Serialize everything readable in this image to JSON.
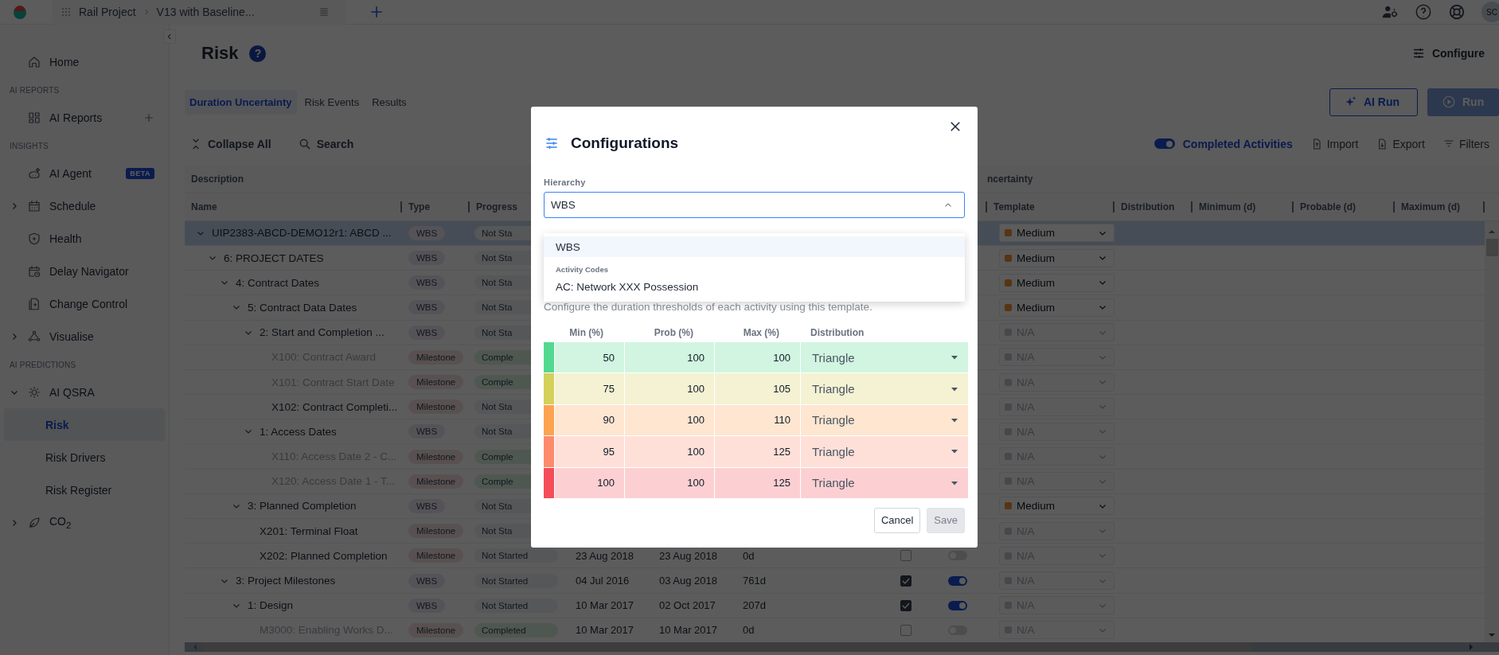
{
  "topbar": {
    "breadcrumb": [
      "Rail Project",
      "V13 with Baseline..."
    ],
    "avatar": "SC"
  },
  "sidebar": {
    "items": [
      {
        "kind": "item",
        "label": "Home",
        "selected": false
      },
      {
        "kind": "section",
        "label": "AI REPORTS"
      },
      {
        "kind": "item",
        "label": "AI Reports",
        "selected": false,
        "add": true
      },
      {
        "kind": "section",
        "label": "INSIGHTS"
      },
      {
        "kind": "item",
        "label": "AI Agent",
        "selected": false,
        "badge": "BETA"
      },
      {
        "kind": "item",
        "label": "Schedule",
        "selected": false,
        "expanded": false
      },
      {
        "kind": "item",
        "label": "Health",
        "selected": false
      },
      {
        "kind": "item",
        "label": "Delay Navigator",
        "selected": false
      },
      {
        "kind": "item",
        "label": "Change Control",
        "selected": false
      },
      {
        "kind": "item",
        "label": "Visualise",
        "selected": false,
        "expanded": false
      },
      {
        "kind": "section",
        "label": "AI PREDICTIONS"
      },
      {
        "kind": "item",
        "label": "AI QSRA",
        "selected": false,
        "expanded": true,
        "children": [
          {
            "label": "Risk",
            "selected": true
          },
          {
            "label": "Risk Drivers",
            "selected": false
          },
          {
            "label": "Risk Register",
            "selected": false
          }
        ]
      },
      {
        "kind": "item",
        "label": "CO$_{2}$",
        "selected": false,
        "expanded": false
      }
    ]
  },
  "page": {
    "title": "Risk",
    "help_glyph": "?",
    "configure": "Configure",
    "tabs": [
      {
        "label": "Duration Uncertainty",
        "selected": true
      },
      {
        "label": "Risk Events",
        "selected": false
      },
      {
        "label": "Results",
        "selected": false
      }
    ],
    "run_buttons": [
      {
        "label": "AI Run",
        "kind": "outline",
        "disabled": false
      },
      {
        "label": "Run",
        "kind": "filled",
        "disabled": true
      }
    ],
    "toolbar": {
      "collapse": "Collapse All",
      "search": "Search",
      "completed": {
        "label": "Completed Activities",
        "on": true
      },
      "actions": [
        "Import",
        "Export",
        "Filters"
      ]
    }
  },
  "table": {
    "group_headers": [
      "Description",
      "ncertainty"
    ],
    "columns": [
      "Name",
      "Type",
      "Progress",
      "Template",
      "Distribution",
      "Minimum (d)",
      "Probable (d)",
      "Maximum (d)"
    ],
    "rows": [
      {
        "name": "UIP2383-ABCD-DEMO12r1: ABCD ...",
        "kind": "wbs",
        "type": "WBS",
        "progress": "Not Sta",
        "completed": false,
        "selected": true,
        "expanded": true,
        "template": {
          "label": "Medium",
          "disabled": false
        },
        "children": [
          {
            "name": "6: PROJECT DATES",
            "kind": "wbs",
            "type": "WBS",
            "progress": "Not Sta",
            "completed": false,
            "selected": false,
            "expanded": true,
            "template": {
              "label": "Medium",
              "disabled": false
            },
            "children": [
              {
                "name": "4: Contract Dates",
                "kind": "wbs",
                "type": "WBS",
                "progress": "Not Sta",
                "completed": false,
                "selected": false,
                "expanded": true,
                "template": {
                  "label": "Medium",
                  "disabled": false
                },
                "children": [
                  {
                    "name": "5: Contract Data Dates",
                    "kind": "wbs",
                    "type": "WBS",
                    "progress": "Not Sta",
                    "completed": false,
                    "selected": false,
                    "expanded": true,
                    "template": {
                      "label": "Medium",
                      "disabled": false
                    },
                    "children": [
                      {
                        "name": "2: Start and Completion ...",
                        "kind": "wbs",
                        "type": "WBS",
                        "progress": "Not Sta",
                        "completed": false,
                        "selected": false,
                        "expanded": true,
                        "template": {
                          "label": "N/A",
                          "disabled": true
                        },
                        "children": [
                          {
                            "name": "X100: Contract Award",
                            "kind": "milestone",
                            "type": "Milestone",
                            "progress": "Comple",
                            "completed": true,
                            "selected": false,
                            "template": {
                              "label": "N/A",
                              "disabled": true
                            }
                          },
                          {
                            "name": "X101: Contract Start Date",
                            "kind": "milestone",
                            "type": "Milestone",
                            "progress": "Comple",
                            "completed": true,
                            "selected": false,
                            "template": {
                              "label": "N/A",
                              "disabled": true
                            }
                          },
                          {
                            "name": "X102: Contract Completi...",
                            "kind": "milestone",
                            "type": "Milestone",
                            "progress": "Not Sta",
                            "completed": false,
                            "selected": false,
                            "template": {
                              "label": "N/A",
                              "disabled": true
                            }
                          }
                        ]
                      },
                      {
                        "name": "1: Access Dates",
                        "kind": "wbs",
                        "type": "WBS",
                        "progress": "Not Sta",
                        "completed": false,
                        "selected": false,
                        "expanded": true,
                        "template": {
                          "label": "N/A",
                          "disabled": true
                        },
                        "children": [
                          {
                            "name": "X110: Access Date 2 - C...",
                            "kind": "milestone",
                            "type": "Milestone",
                            "progress": "Comple",
                            "completed": true,
                            "selected": false,
                            "template": {
                              "label": "N/A",
                              "disabled": true
                            }
                          },
                          {
                            "name": "X120: Access Date 1 - T...",
                            "kind": "milestone",
                            "type": "Milestone",
                            "progress": "Comple",
                            "completed": true,
                            "selected": false,
                            "template": {
                              "label": "N/A",
                              "disabled": true
                            }
                          }
                        ]
                      }
                    ]
                  },
                  {
                    "name": "3: Planned Completion",
                    "kind": "wbs",
                    "type": "WBS",
                    "progress": "Not Sta",
                    "completed": false,
                    "selected": false,
                    "expanded": true,
                    "template": {
                      "label": "Medium",
                      "disabled": false
                    },
                    "children": [
                      {
                        "name": "X201: Terminal Float",
                        "kind": "milestone",
                        "type": "Milestone",
                        "progress": "Not Sta",
                        "completed": false,
                        "selected": false,
                        "template": {
                          "label": "N/A",
                          "disabled": true
                        }
                      },
                      {
                        "name": "X202: Planned Completion",
                        "kind": "milestone",
                        "type": "Milestone",
                        "progress": "Not Started",
                        "completed": false,
                        "selected": false,
                        "start": "23 Aug 2018",
                        "finish": "23 Aug 2018",
                        "duration": "0d",
                        "checked": false,
                        "toggle_on": false,
                        "template": {
                          "label": "N/A",
                          "disabled": true
                        }
                      }
                    ]
                  }
                ]
              },
              {
                "name": "3: Project Milestones",
                "kind": "wbs",
                "type": "WBS",
                "progress": "Not Started",
                "completed": false,
                "selected": false,
                "expanded": true,
                "start": "04 Jul 2016",
                "finish": "03 Aug 2018",
                "duration": "761d",
                "checked": true,
                "toggle_on": true,
                "template": {
                  "label": "N/A",
                  "disabled": true
                },
                "children": [
                  {
                    "name": "1: Design",
                    "kind": "wbs",
                    "type": "WBS",
                    "progress": "Not Started",
                    "completed": false,
                    "selected": false,
                    "expanded": true,
                    "start": "10 Mar 2017",
                    "finish": "02 Oct 2017",
                    "duration": "207d",
                    "checked": true,
                    "toggle_on": true,
                    "template": {
                      "label": "N/A",
                      "disabled": true
                    },
                    "children": [
                      {
                        "name": "M3000: Enabling Works D...",
                        "kind": "milestone",
                        "type": "Milestone",
                        "progress": "Completed",
                        "completed": true,
                        "selected": false,
                        "start": "10 Mar 2017",
                        "finish": "10 Mar 2017",
                        "duration": "0d",
                        "checked": false,
                        "toggle_on": false,
                        "template": {
                          "label": "N/A",
                          "disabled": true
                        }
                      }
                    ]
                  }
                ]
              }
            ]
          }
        ]
      }
    ]
  },
  "dialog": {
    "title": "Configurations",
    "hierarchy_label": "Hierarchy",
    "hierarchy_value": "WBS",
    "dropdown": {
      "expanded": true,
      "options": [
        {
          "kind": "option",
          "label": "WBS",
          "selected": true
        },
        {
          "kind": "group",
          "label": "Activity Codes"
        },
        {
          "kind": "option",
          "label": "AC: Network XXX Possession",
          "selected": false
        }
      ]
    },
    "description": "Configure the duration thresholds of each activity using this template.",
    "columns": [
      "Min (%)",
      "Prob (%)",
      "Max (%)",
      "Distribution"
    ],
    "thresholds": [
      {
        "color": "#52d98f",
        "min": "50",
        "prob": "100",
        "max": "100",
        "distribution": "Triangle"
      },
      {
        "color": "#d4d05a",
        "min": "75",
        "prob": "100",
        "max": "105",
        "distribution": "Triangle"
      },
      {
        "color": "#fda350",
        "min": "90",
        "prob": "100",
        "max": "110",
        "distribution": "Triangle"
      },
      {
        "color": "#fd8b6b",
        "min": "95",
        "prob": "100",
        "max": "125",
        "distribution": "Triangle"
      },
      {
        "color": "#f54d58",
        "min": "100",
        "prob": "100",
        "max": "125",
        "distribution": "Triangle"
      }
    ],
    "buttons": [
      {
        "label": "Cancel",
        "kind": "secondary",
        "disabled": false
      },
      {
        "label": "Save",
        "kind": "primary",
        "disabled": true
      }
    ]
  }
}
